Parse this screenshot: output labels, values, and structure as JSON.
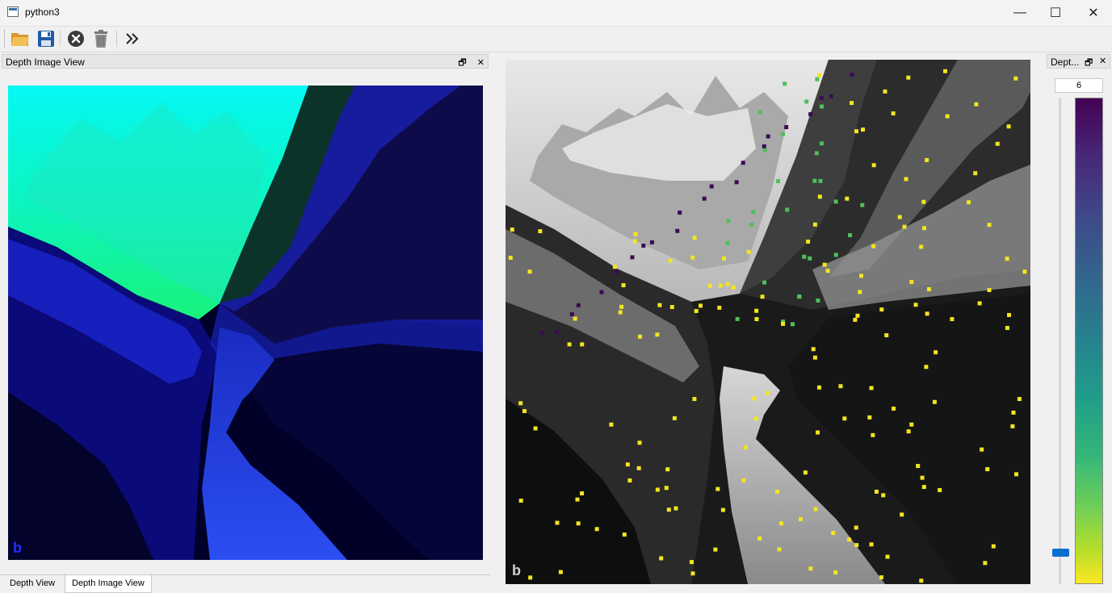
{
  "window": {
    "title": "python3",
    "minimize": "—",
    "maximize": "☐",
    "close": "✕"
  },
  "toolbar": {
    "items": [
      {
        "name": "open-folder-icon"
      },
      {
        "name": "save-icon"
      },
      {
        "name": "clear-icon"
      },
      {
        "name": "trash-icon"
      },
      {
        "name": "more-chevrons-icon",
        "label": "»"
      }
    ]
  },
  "left_dock": {
    "title": "Depth Image View",
    "float_btn": "🗗",
    "close_btn": "✕",
    "tabs": [
      "Depth View",
      "Depth Image View"
    ],
    "active_tab": 1,
    "watermark": "b"
  },
  "right_view": {
    "watermark": "b"
  },
  "depth_dock": {
    "title": "Dept...",
    "float_btn": "🗗",
    "close_btn": "✕",
    "depth_value": "6",
    "slider_level": 0.04,
    "colormap": [
      "#440154",
      "#3e4a89",
      "#26828e",
      "#35b779",
      "#fde725"
    ]
  },
  "colors": {
    "point_yellow": "#f4e51f",
    "point_green": "#4fbf5a",
    "point_purple": "#3d0a56",
    "accent": "#0a6fd1"
  }
}
